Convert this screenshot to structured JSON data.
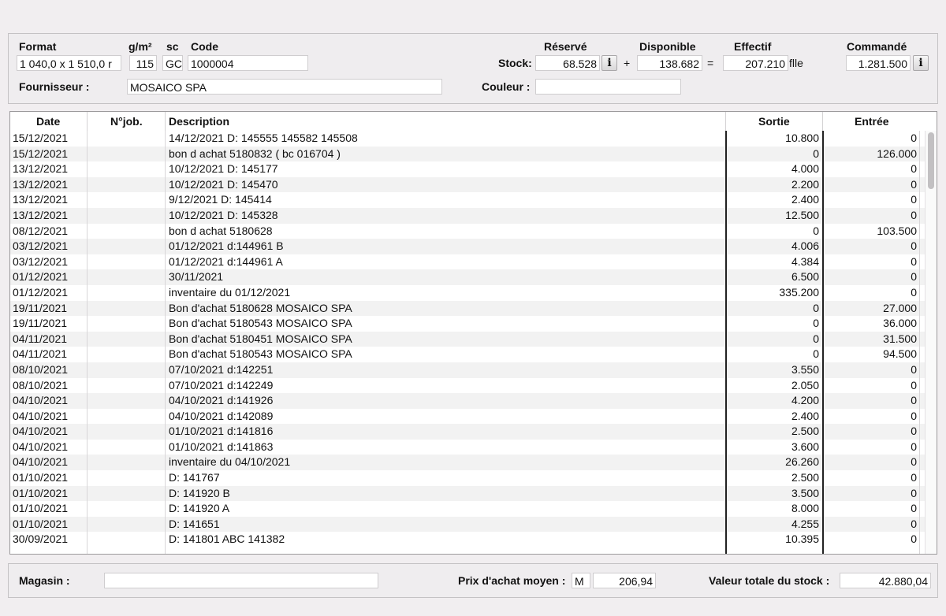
{
  "header": {
    "format_label": "Format",
    "format_value": "1 040,0 x 1 510,0 r",
    "gsm_label": "g/m²",
    "gsm_value": "115",
    "sc_label": "sc",
    "sc_value": "GC",
    "code_label": "Code",
    "code_value": "1000004",
    "fournisseur_label": "Fournisseur :",
    "fournisseur_value": "MOSAICO SPA",
    "stock_label": "Stock:",
    "reserve_label": "Réservé",
    "reserve_value": "68.528",
    "plus": "+",
    "disponible_label": "Disponible",
    "disponible_value": "138.682",
    "equals": "=",
    "effectif_label": "Effectif",
    "effectif_value": "207.210",
    "unit": "flle",
    "commande_label": "Commandé",
    "commande_value": "1.281.500",
    "couleur_label": "Couleur :",
    "couleur_value": "",
    "info_glyph": "i"
  },
  "table": {
    "columns": [
      "Date",
      "N°job.",
      "Description",
      "Sortie",
      "Entrée"
    ],
    "rows": [
      {
        "date": "15/12/2021",
        "job": "",
        "desc": "14/12/2021 D: 145555  145582  145508",
        "sortie": "10.800",
        "entree": "0"
      },
      {
        "date": "15/12/2021",
        "job": "",
        "desc": "bon d achat 5180832  ( bc 016704 )",
        "sortie": "0",
        "entree": "126.000"
      },
      {
        "date": "13/12/2021",
        "job": "",
        "desc": "10/12/2021 D: 145177",
        "sortie": "4.000",
        "entree": "0"
      },
      {
        "date": "13/12/2021",
        "job": "",
        "desc": "10/12/2021 D: 145470",
        "sortie": "2.200",
        "entree": "0"
      },
      {
        "date": "13/12/2021",
        "job": "",
        "desc": "9/12/2021 D: 145414",
        "sortie": "2.400",
        "entree": "0"
      },
      {
        "date": "13/12/2021",
        "job": "",
        "desc": "10/12/2021 D: 145328",
        "sortie": "12.500",
        "entree": "0"
      },
      {
        "date": "08/12/2021",
        "job": "",
        "desc": "bon d achat 5180628",
        "sortie": "0",
        "entree": "103.500"
      },
      {
        "date": "03/12/2021",
        "job": "",
        "desc": "01/12/2021 d:144961 B",
        "sortie": "4.006",
        "entree": "0"
      },
      {
        "date": "03/12/2021",
        "job": "",
        "desc": "01/12/2021 d:144961 A",
        "sortie": "4.384",
        "entree": "0"
      },
      {
        "date": "01/12/2021",
        "job": "",
        "desc": "30/11/2021",
        "sortie": "6.500",
        "entree": "0"
      },
      {
        "date": "01/12/2021",
        "job": "",
        "desc": "inventaire du 01/12/2021",
        "sortie": "335.200",
        "entree": "0"
      },
      {
        "date": "19/11/2021",
        "job": "",
        "desc": "Bon d'achat 5180628 MOSAICO SPA",
        "sortie": "0",
        "entree": "27.000"
      },
      {
        "date": "19/11/2021",
        "job": "",
        "desc": "Bon d'achat 5180543 MOSAICO SPA",
        "sortie": "0",
        "entree": "36.000"
      },
      {
        "date": "04/11/2021",
        "job": "",
        "desc": "Bon d'achat 5180451 MOSAICO SPA",
        "sortie": "0",
        "entree": "31.500"
      },
      {
        "date": "04/11/2021",
        "job": "",
        "desc": "Bon d'achat 5180543 MOSAICO SPA",
        "sortie": "0",
        "entree": "94.500"
      },
      {
        "date": "08/10/2021",
        "job": "",
        "desc": "07/10/2021 d:142251",
        "sortie": "3.550",
        "entree": "0"
      },
      {
        "date": "08/10/2021",
        "job": "",
        "desc": "07/10/2021 d:142249",
        "sortie": "2.050",
        "entree": "0"
      },
      {
        "date": "04/10/2021",
        "job": "",
        "desc": "04/10/2021 d:141926",
        "sortie": "4.200",
        "entree": "0"
      },
      {
        "date": "04/10/2021",
        "job": "",
        "desc": "04/10/2021 d:142089",
        "sortie": "2.400",
        "entree": "0"
      },
      {
        "date": "04/10/2021",
        "job": "",
        "desc": "01/10/2021 d:141816",
        "sortie": "2.500",
        "entree": "0"
      },
      {
        "date": "04/10/2021",
        "job": "",
        "desc": "01/10/2021 d:141863",
        "sortie": "3.600",
        "entree": "0"
      },
      {
        "date": "04/10/2021",
        "job": "",
        "desc": "inventaire du 04/10/2021",
        "sortie": "26.260",
        "entree": "0"
      },
      {
        "date": "01/10/2021",
        "job": "",
        "desc": "D: 141767",
        "sortie": "2.500",
        "entree": "0"
      },
      {
        "date": "01/10/2021",
        "job": "",
        "desc": "D: 141920 B",
        "sortie": "3.500",
        "entree": "0"
      },
      {
        "date": "01/10/2021",
        "job": "",
        "desc": "D: 141920 A",
        "sortie": "8.000",
        "entree": "0"
      },
      {
        "date": "01/10/2021",
        "job": "",
        "desc": "D: 141651",
        "sortie": "4.255",
        "entree": "0"
      },
      {
        "date": "30/09/2021",
        "job": "",
        "desc": "D: 141801 ABC  141382",
        "sortie": "10.395",
        "entree": "0"
      }
    ]
  },
  "footer": {
    "magasin_label": "Magasin :",
    "magasin_value": "",
    "prix_label": "Prix d'achat moyen :",
    "prix_unit": "M",
    "prix_value": "206,94",
    "valeur_label": "Valeur totale du stock :",
    "valeur_value": "42.880,04"
  }
}
